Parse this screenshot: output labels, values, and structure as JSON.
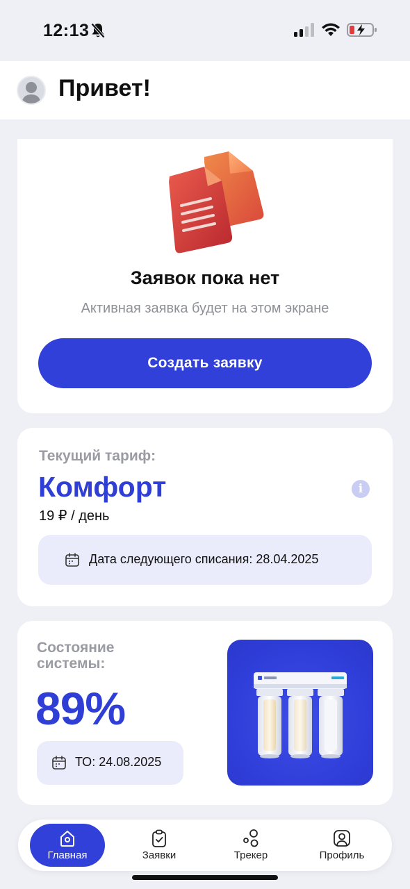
{
  "status_bar": {
    "time": "12:13",
    "icons": [
      "bell-muted-icon",
      "cellular-signal-icon",
      "wifi-icon",
      "battery-charging-icon"
    ]
  },
  "header": {
    "greeting": "Привет!",
    "avatar_icon": "user-avatar-icon"
  },
  "requests_card": {
    "illustration_icon": "documents-icon",
    "title": "Заявок пока нет",
    "subtitle": "Активная заявка будет на этом экране",
    "create_button_label": "Создать заявку"
  },
  "tariff_card": {
    "label": "Текущий тариф:",
    "name": "Комфорт",
    "price": "19 ₽ / день",
    "info_icon": "info-icon",
    "info_glyph": "i",
    "next_charge": "Дата следующего списания: 28.04.2025"
  },
  "system_card": {
    "label": "Состояние системы:",
    "percent": "89%",
    "maintenance": "ТО: 24.08.2025",
    "image_icon": "water-filter-image"
  },
  "bottom_nav": {
    "items": [
      {
        "label": "Главная",
        "icon": "home-icon",
        "active": true
      },
      {
        "label": "Заявки",
        "icon": "clipboard-check-icon",
        "active": false
      },
      {
        "label": "Трекер",
        "icon": "bubbles-icon",
        "active": false
      },
      {
        "label": "Профиль",
        "icon": "profile-icon",
        "active": false
      }
    ]
  },
  "colors": {
    "accent": "#3140d8",
    "background": "#eef0f6",
    "card": "#ffffff",
    "muted_text": "#9a9ba3",
    "soft_panel": "#eaecfb"
  }
}
